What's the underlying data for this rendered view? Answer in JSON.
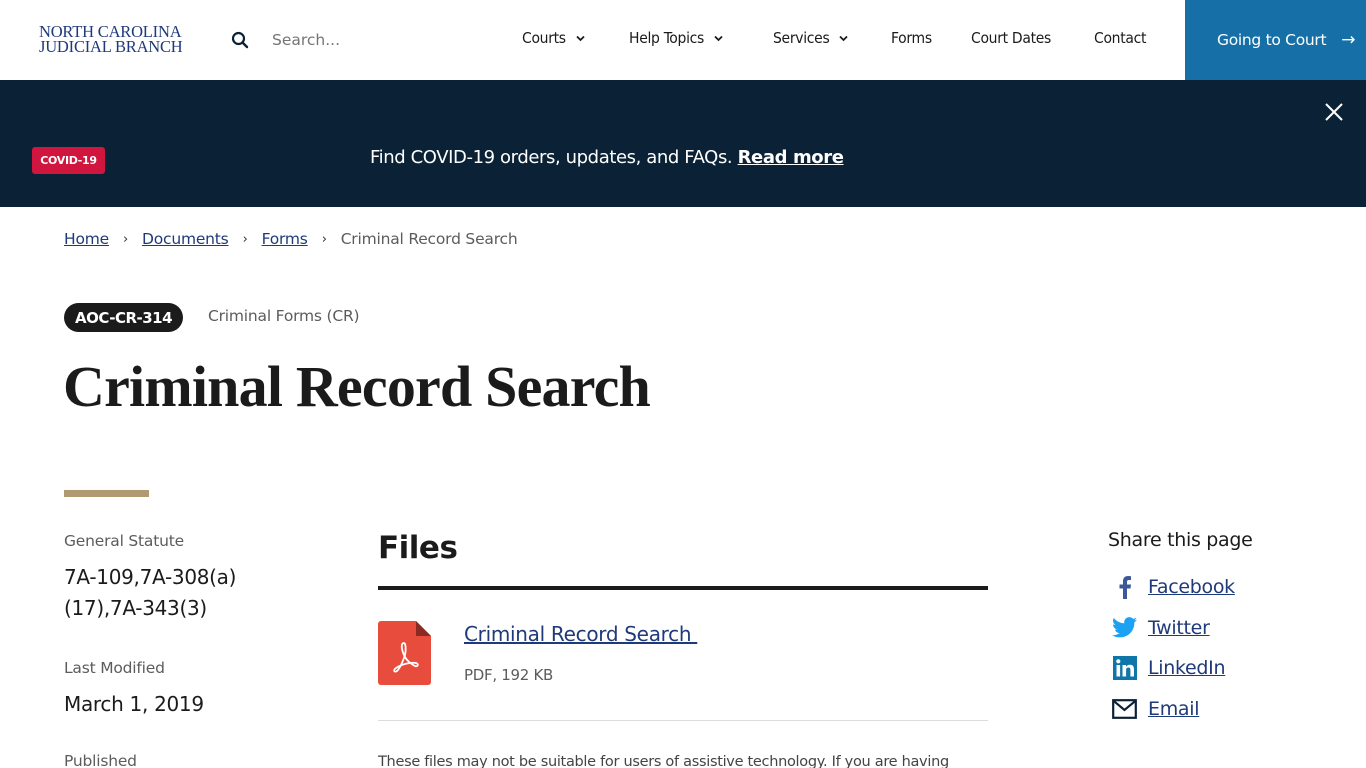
{
  "header": {
    "logo_line1": "NORTH CAROLINA",
    "logo_line2": "JUDICIAL BRANCH",
    "search_placeholder": "Search...",
    "nav": [
      {
        "label": "Courts",
        "has_dropdown": true
      },
      {
        "label": "Help Topics",
        "has_dropdown": true
      },
      {
        "label": "Services",
        "has_dropdown": true
      },
      {
        "label": "Forms",
        "has_dropdown": false
      },
      {
        "label": "Court Dates",
        "has_dropdown": false
      },
      {
        "label": "Contact",
        "has_dropdown": false
      }
    ],
    "cta_label": "Going to Court",
    "cta_icon": "arrow-right-icon",
    "cta_color": "#1670a7"
  },
  "alert": {
    "badge": "COVID-19",
    "badge_color": "#d0153e",
    "message": "Find COVID-19 orders, updates, and FAQs.",
    "link_label": "Read more",
    "background": "#0b2236",
    "close_icon": "close-icon"
  },
  "breadcrumb": {
    "items": [
      {
        "label": "Home",
        "link": true
      },
      {
        "label": "Documents",
        "link": true
      },
      {
        "label": "Forms",
        "link": true
      },
      {
        "label": "Criminal Record Search",
        "link": false
      }
    ],
    "separator": "›"
  },
  "form": {
    "code": "AOC-CR-314",
    "category": "Criminal Forms (CR)",
    "title": "Criminal Record Search"
  },
  "meta": {
    "statute_label": "General Statute",
    "statute_line1": "7A-109,7A-308(a)",
    "statute_line2": "(17),7A-343(3)",
    "modified_label": "Last Modified",
    "modified_value": "March 1, 2019",
    "published_label": "Published"
  },
  "files": {
    "heading": "Files",
    "items": [
      {
        "name": "Criminal Record Search ",
        "meta": "PDF, 192 KB",
        "icon": "pdf-icon"
      }
    ],
    "note": "These files may not be suitable for users of assistive technology. If you are having"
  },
  "share": {
    "heading": "Share this page",
    "items": [
      {
        "label": "Facebook",
        "icon": "facebook-icon",
        "color": "#3b5998"
      },
      {
        "label": "Twitter",
        "icon": "twitter-icon",
        "color": "#1da1f2"
      },
      {
        "label": "LinkedIn",
        "icon": "linkedin-icon",
        "color": "#0e76a8"
      },
      {
        "label": "Email",
        "icon": "email-icon",
        "color": "#0b2236"
      }
    ]
  }
}
